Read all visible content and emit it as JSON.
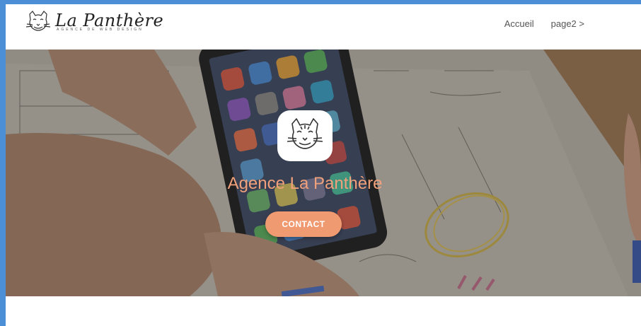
{
  "header": {
    "logo_title": "La Panthère",
    "logo_subtitle": "Agence de web design",
    "nav": [
      {
        "label": "Accueil"
      },
      {
        "label": "page2 >"
      }
    ]
  },
  "hero": {
    "title": "Agence La Panthère",
    "contact_label": "CONTACT",
    "icon": "panther-icon"
  },
  "colors": {
    "accent": "#f09a72",
    "title": "#f0a07a",
    "frame_background": "#4d8fd6"
  }
}
